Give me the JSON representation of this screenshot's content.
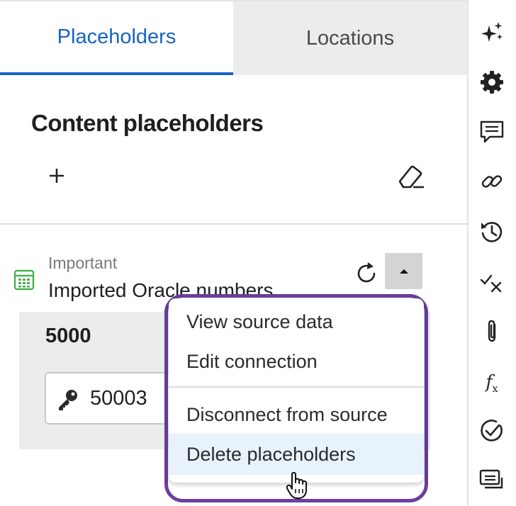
{
  "tabs": [
    {
      "label": "Placeholders",
      "active": true
    },
    {
      "label": "Locations",
      "active": false
    }
  ],
  "section": {
    "title": "Content placeholders"
  },
  "toolbar": {
    "add_icon": "plus-icon",
    "clear_icon": "eraser-icon"
  },
  "placeholder_item": {
    "icon": "spreadsheet-icon",
    "category": "Important",
    "name": "Imported Oracle numbers",
    "value": "5000",
    "key": "50003",
    "key_icon": "key-icon"
  },
  "context_menu": {
    "items": [
      {
        "label": "View source data"
      },
      {
        "label": "Edit connection"
      },
      {
        "label": "Disconnect from source"
      },
      {
        "label": "Delete placeholders",
        "highlighted": true
      }
    ]
  },
  "right_rail": {
    "icons": [
      "sparkle-icon",
      "gear-icon",
      "comment-icon",
      "link-icon",
      "history-icon",
      "checklist-icon",
      "paperclip-icon",
      "function-icon",
      "check-circle-icon",
      "cards-icon"
    ],
    "function_label": "f",
    "function_sub": "x"
  },
  "colors": {
    "accent": "#1565c0",
    "highlight_border": "#6b3fa0",
    "menu_hover": "#e8f2fc"
  }
}
